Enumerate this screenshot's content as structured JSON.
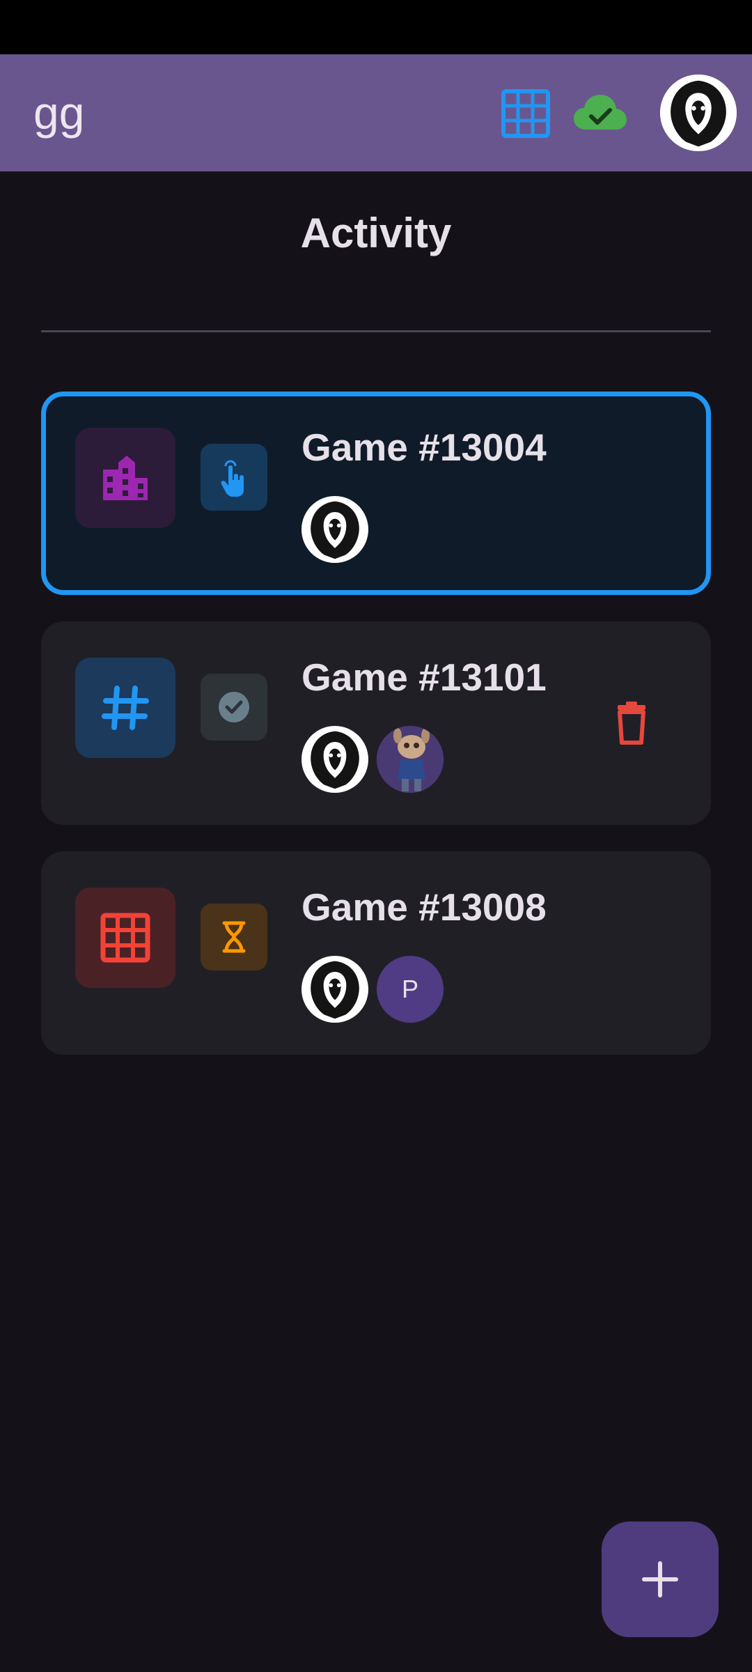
{
  "app_bar": {
    "title": "gg",
    "grid_icon": "grid-icon",
    "sync_icon": "cloud-done-icon",
    "avatar_icon": "lion-avatar-icon"
  },
  "page": {
    "heading": "Activity"
  },
  "games": [
    {
      "title": "Game #13004",
      "mode_icon": "city-icon",
      "status_icon": "tap-icon",
      "selected": true,
      "players": [
        {
          "type": "lion-avatar"
        }
      ],
      "deletable": false
    },
    {
      "title": "Game #13101",
      "mode_icon": "hashtag-icon",
      "status_icon": "check-circle-icon",
      "selected": false,
      "players": [
        {
          "type": "lion-avatar"
        },
        {
          "type": "character-photo-avatar"
        }
      ],
      "deletable": true
    },
    {
      "title": "Game #13008",
      "mode_icon": "grid-icon",
      "status_icon": "hourglass-icon",
      "selected": false,
      "players": [
        {
          "type": "lion-avatar"
        },
        {
          "type": "letter-avatar",
          "letter": "P"
        }
      ],
      "deletable": false
    }
  ],
  "fab": {
    "icon": "plus-icon"
  },
  "colors": {
    "app_bar": "#6a568e",
    "background": "#141218",
    "selected_border": "#2196f3",
    "delete": "#e5483c",
    "sync_green": "#4caf50"
  }
}
